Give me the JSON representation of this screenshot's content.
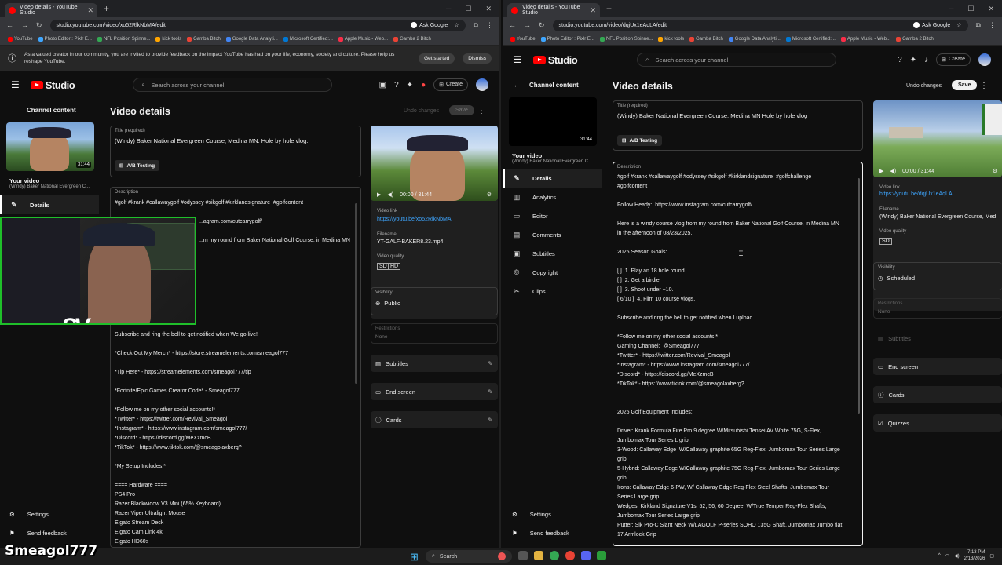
{
  "left": {
    "tab_title": "Video details - YouTube Studio",
    "url": "studio.youtube.com/video/xo52RlkNbMA/edit",
    "ask_google": "Ask Google",
    "bookmarks": [
      "YouTube",
      "Photo Editor : Pixlr E...",
      "NFL Position Spinne...",
      "kick tools",
      "Gamba Bitch",
      "Google Data Analyti...",
      "Microsoft Certified:...",
      "Apple Music - Web...",
      "Gamba 2 Bitch"
    ],
    "notice": {
      "text": "As a valued creator in our community, you are invited to provide feedback on the impact YouTube has had on your life, economy, society and culture. Please help us reshape YouTube.",
      "get_started": "Get started",
      "dismiss": "Dismiss"
    },
    "studio": "Studio",
    "search_placeholder": "Search across your channel",
    "create": "Create",
    "channel_content": "Channel content",
    "duration": "31:44",
    "your_video": "Your video",
    "channel_sub": "(Windy) Baker National Evergreen C...",
    "nav_details": "Details",
    "settings": "Settings",
    "send_feedback": "Send feedback",
    "page_title": "Video details",
    "undo": "Undo changes",
    "save": "Save",
    "title_label": "Title (required)",
    "title_value": "(Windy) Baker National Evergreen Course, Medina MN.  Hole by hole vlog.",
    "ab_testing": "A/B Testing",
    "desc_label": "Description",
    "desc_line1": "#golf #krank #callawaygolf #odyssey #sikgolf #kirklandsignature  #golfcontent",
    "desc_part1": "...agram.com/cutcarrygolf/",
    "desc_part2": "...m my round from Baker National Golf Course, in Medina MN",
    "desc_rest": "Subscribe and ring the bell to get notified when We go live!\n\n*Check Out My Merch* - https://store.streamelements.com/smeagol777\n\n*Tip Here* - https://streamelements.com/smeagol777/tip\n\n*Fortnite/Epic Games Creator Code* - Smeagol777\n\n*Follow me on my other social accounts!*\n*Twitter* - https://twitter.com/Revival_Smeagol\n*Instagram* - https://www.instagram.com/smeagol777/\n*Discord* - https://discord.gg/MeXzmcB\n*TikTok* - https://www.tiktok.com/@smeagolaxberg?\n\n*My Setup Includes:*\n\n==== Hardware ====\nPS4 Pro\nRazer Blackwidow V3 Mini (65% Keyboard)\nRazer Viper Ultralight Mouse\nElgato Stream Deck\nElgato Cam Link 4k\nElgato HD60s",
    "video_time": "00:00 / 31:44",
    "video_link_label": "Video link",
    "video_link": "https://youtu.be/xo52RlkNbMA",
    "filename_label": "Filename",
    "filename": "YT-GALF-BAKER8.23.mp4",
    "quality_label": "Video quality",
    "visibility_label": "Visibility",
    "visibility": "Public",
    "restrictions_label": "Restrictions",
    "restrictions": "None",
    "subtitles": "Subtitles",
    "end_screen": "End screen",
    "cards": "Cards"
  },
  "right": {
    "tab_title": "Video details - YouTube Studio",
    "url": "studio.youtube.com/video/dqjUx1eAqLA/edit",
    "ask_google": "Ask Google",
    "bookmarks": [
      "YouTube",
      "Photo Editor : Pixlr E...",
      "NFL Position Spinne...",
      "kick tools",
      "Gamba Bitch",
      "Google Data Analyti...",
      "Microsoft Certified:...",
      "Apple Music - Web...",
      "Gamba 2 Bitch"
    ],
    "studio": "Studio",
    "search_placeholder": "Search across your channel",
    "create": "Create",
    "channel_content": "Channel content",
    "duration": "31:44",
    "your_video": "Your video",
    "channel_sub": "(Windy) Baker National Evergreen C...",
    "nav": [
      "Details",
      "Analytics",
      "Editor",
      "Comments",
      "Subtitles",
      "Copyright",
      "Clips"
    ],
    "settings": "Settings",
    "send_feedback": "Send feedback",
    "page_title": "Video details",
    "undo": "Undo changes",
    "save": "Save",
    "title_label": "Title (required)",
    "title_value": "(Windy) Baker National Evergreen Course, Medina MN   Hole by hole vlog",
    "ab_testing": "A/B Testing",
    "desc_label": "Description",
    "desc_text": "#golf #krank #callawaygolf #odyssey #sikgolf #kirklandsignature  #golfchallenge\n#golfcontent\n\nFollow Heady:  https://www.instagram.com/cutcarrygolf/\n\nHere is a windy course vlog from my round from Baker National Golf Course, in Medina MN\nin the afternoon of 08/23/2025.\n\n2025 Season Goals:\n\n[ ]  1. Play an 18 hole round.\n[ ]  2. Get a birdie\n[ ]  3. Shoot under +10.\n[ 6/10 ]  4. Film 10 course vlogs.\n\nSubscribe and ring the bell to get notified when I upload\n\n*Follow me on my other social accounts!*\nGaming Channel:  @Smeagol777\n*Twitter* - https://twitter.com/Revival_Smeagol\n*Instagram* - https://www.instagram.com/smeagol777/\n*Discord* - https://discord.gg/MeXzmcB\n*TikTok* - https://www.tiktok.com/@smeagolaxberg?\n\n\n2025 Golf Equipment Includes:\n\nDriver: Krank Formula Fire Pro 9 degree W/Mitsubishi Tensei AV White 75G, S-Flex,\nJumbomax Tour Series L grip\n3-Wood: Callaway Edge  W/Callaway graphite 65G Reg-Flex, Jumbomax Tour Series Large\ngrip\n5-Hybrid: Callaway Edge W/Callaway graphite 75G Reg-Flex, Jumbomax Tour Series Large\ngrip\nIrons: Callaway Edge 6-PW, W/ Callaway Edge Reg-Flex Steel Shafts, Jumbomax Tour\nSeries Large grip\nWedges: Kirkland Signature V1s: 52, 56, 60 Degree, W/True Temper Reg-Flex Shafts,\nJumbomax Tour Series Large grip\nPutter: Sik Pro-C Slant Neck W/LAGOLF P-series SOHO 135G Shaft, Jumbomax Jumbo flat\n17 Armlock Grip",
    "video_time": "00:00 / 31:44",
    "video_link_label": "Video link",
    "video_link": "https://youtu.be/dqjUx1eAqLA",
    "filename_label": "Filename",
    "filename": "(Windy) Baker National Evergreen Course, Med",
    "quality_label": "Video quality",
    "visibility_label": "Visibility",
    "visibility": "Scheduled",
    "restrictions_label": "Restrictions",
    "restrictions": "None",
    "subtitles": "Subtitles",
    "end_screen": "End screen",
    "cards": "Cards",
    "quizzes": "Quizzes"
  },
  "taskbar": {
    "search": "Search",
    "time": "7:13 PM",
    "date": "2/13/2026"
  },
  "overlay_name": "Smeagol777"
}
